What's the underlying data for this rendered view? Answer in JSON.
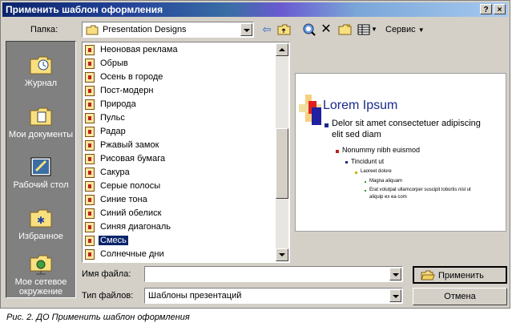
{
  "window": {
    "title": "Применить шаблон оформления"
  },
  "titlebar_buttons": {
    "help": "?",
    "close": "×"
  },
  "folder": {
    "label": "Папка:",
    "value": "Presentation Designs"
  },
  "toolbar": {
    "tools_label": "Сервис"
  },
  "places": [
    {
      "label": "Журнал"
    },
    {
      "label": "Мои документы"
    },
    {
      "label": "Рабочий стол"
    },
    {
      "label": "Избранное"
    },
    {
      "label_line1": "Мое сетевое",
      "label_line2": "окружение"
    }
  ],
  "files": [
    "Неоновая реклама",
    "Обрыв",
    "Осень в городе",
    "Пост-модерн",
    "Природа",
    "Пульс",
    "Радар",
    "Ржавый замок",
    "Рисовая бумага",
    "Сакура",
    "Серые полосы",
    "Синие тона",
    "Синий обелиск",
    "Синяя диагональ",
    "Смесь",
    "Солнечные дни"
  ],
  "selected_file": "Смесь",
  "preview": {
    "title": "Lorem Ipsum",
    "bullet1_line1": "Delor sit amet consectetuer adipiscing",
    "bullet1_line2": "elit sed diam",
    "bullet2": "Nonummy nibh euismod",
    "bullet3": "Tincidunt ut",
    "bullet4": "Laoreet dolore",
    "bullet5": "Magna aliquam",
    "bullet6_line1": "Erat volutpat ullamcorper suscipit lobortis nisl ut",
    "bullet6_line2": "aliquip ex ea com"
  },
  "filename": {
    "label": "Имя файла:",
    "value": ""
  },
  "filetype": {
    "label": "Тип файлов:",
    "value": "Шаблоны презентаций"
  },
  "buttons": {
    "apply": "Применить",
    "cancel": "Отмена"
  },
  "caption": "Рис. 2. ДО Применить шаблон оформления",
  "colors": {
    "selection": "#0a246a",
    "dialog": "#d4d0c8"
  }
}
